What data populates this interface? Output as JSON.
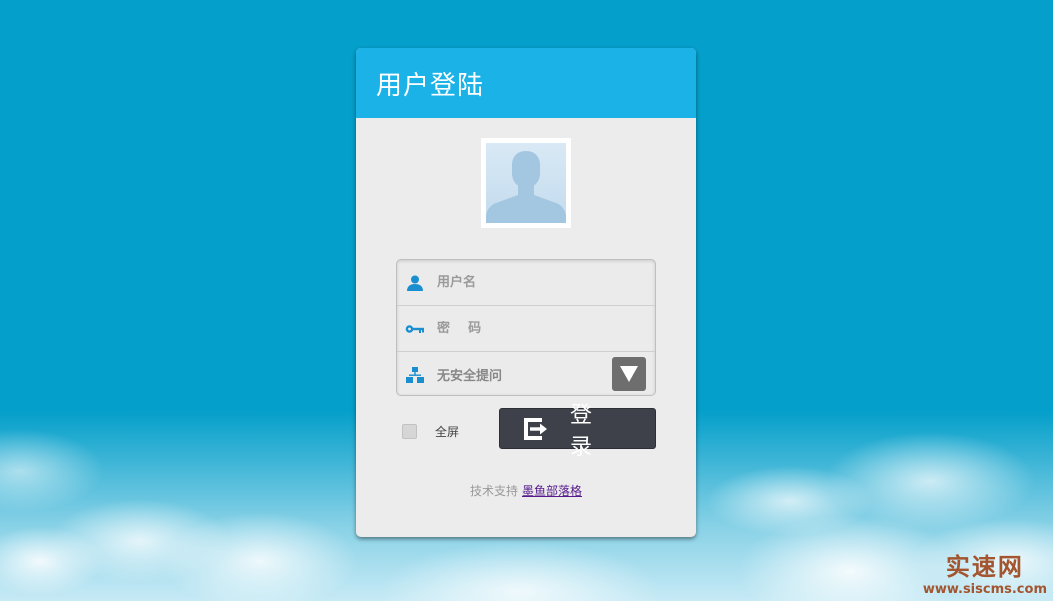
{
  "page": {
    "background_color": "#049fca"
  },
  "login": {
    "title": "用户登陆",
    "username": {
      "placeholder": "用户名",
      "icon": "user-icon"
    },
    "password": {
      "placeholder": "密    码",
      "icon": "key-icon"
    },
    "security_question": {
      "selected": "无安全提问",
      "icon": "sitemap-icon",
      "button_icon": "triangle-down-icon"
    },
    "fullscreen_label": "全屏",
    "submit_label": "登 录",
    "submit_icon": "login-enter-icon",
    "support_text": "技术支持",
    "support_link": "墨鱼部落格"
  },
  "watermark": {
    "title": "实速网",
    "url": "www.siscms.com"
  },
  "colors": {
    "header": "#1bb2e8",
    "card": "#ececec",
    "button": "#3e4149",
    "watermark": "#a2552e"
  }
}
